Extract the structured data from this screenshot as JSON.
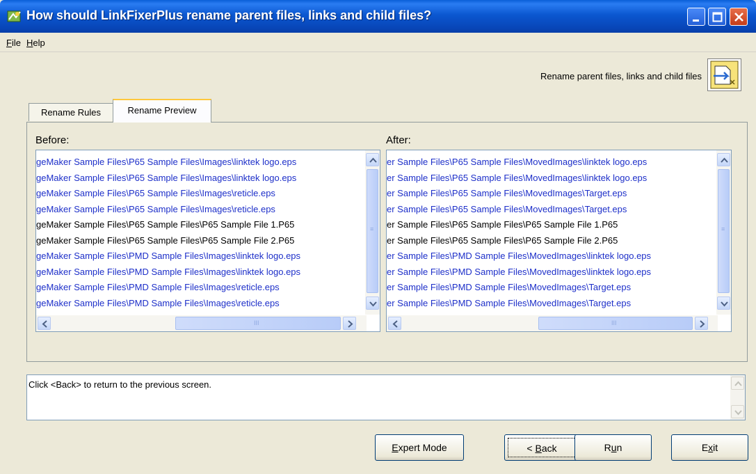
{
  "window": {
    "title": "How should LinkFixerPlus rename parent files, links and child files?"
  },
  "menu": {
    "file": {
      "label_rest": "ile",
      "accel": "F"
    },
    "help": {
      "label_rest": "elp",
      "accel": "H"
    }
  },
  "header": {
    "caption": "Rename parent files, links and child files",
    "icon": "rename-files-icon"
  },
  "tabs": [
    {
      "label": "Rename Rules",
      "selected": false
    },
    {
      "label": "Rename Preview",
      "selected": true
    }
  ],
  "before": {
    "label": "Before:",
    "rows": [
      {
        "text": "geMaker Sample Files\\P65 Sample Files\\Images\\linktek logo.eps",
        "color": "blue"
      },
      {
        "text": "geMaker Sample Files\\P65 Sample Files\\Images\\linktek logo.eps",
        "color": "blue"
      },
      {
        "text": "geMaker Sample Files\\P65 Sample Files\\Images\\reticle.eps",
        "color": "blue"
      },
      {
        "text": "geMaker Sample Files\\P65 Sample Files\\Images\\reticle.eps",
        "color": "blue"
      },
      {
        "text": "geMaker Sample Files\\P65 Sample Files\\P65 Sample File 1.P65",
        "color": "black"
      },
      {
        "text": "geMaker Sample Files\\P65 Sample Files\\P65 Sample File 2.P65",
        "color": "black"
      },
      {
        "text": "geMaker Sample Files\\PMD Sample Files\\Images\\linktek logo.eps",
        "color": "blue"
      },
      {
        "text": "geMaker Sample Files\\PMD Sample Files\\Images\\linktek logo.eps",
        "color": "blue"
      },
      {
        "text": "geMaker Sample Files\\PMD Sample Files\\Images\\reticle.eps",
        "color": "blue"
      },
      {
        "text": "geMaker Sample Files\\PMD Sample Files\\Images\\reticle.eps",
        "color": "blue"
      }
    ]
  },
  "after": {
    "label": "After:",
    "rows": [
      {
        "text": "er Sample Files\\P65 Sample Files\\MovedImages\\linktek logo.eps",
        "color": "blue"
      },
      {
        "text": "er Sample Files\\P65 Sample Files\\MovedImages\\linktek logo.eps",
        "color": "blue"
      },
      {
        "text": "er Sample Files\\P65 Sample Files\\MovedImages\\Target.eps",
        "color": "blue"
      },
      {
        "text": "er Sample Files\\P65 Sample Files\\MovedImages\\Target.eps",
        "color": "blue"
      },
      {
        "text": "er Sample Files\\P65 Sample Files\\P65 Sample File 1.P65",
        "color": "black"
      },
      {
        "text": "er Sample Files\\P65 Sample Files\\P65 Sample File 2.P65",
        "color": "black"
      },
      {
        "text": "er Sample Files\\PMD Sample Files\\MovedImages\\linktek logo.eps",
        "color": "blue"
      },
      {
        "text": "er Sample Files\\PMD Sample Files\\MovedImages\\linktek logo.eps",
        "color": "blue"
      },
      {
        "text": "er Sample Files\\PMD Sample Files\\MovedImages\\Target.eps",
        "color": "blue"
      },
      {
        "text": "er Sample Files\\PMD Sample Files\\MovedImages\\Target.eps",
        "color": "blue"
      }
    ]
  },
  "status": {
    "message": "Click <Back> to return to the previous screen."
  },
  "buttons": {
    "expert": {
      "accel": "E",
      "rest": "xpert Mode"
    },
    "back": {
      "pre": "< ",
      "accel": "B",
      "rest": "ack"
    },
    "run": {
      "pre": "R",
      "accel": "u",
      "rest": "n"
    },
    "exit": {
      "pre": "E",
      "accel": "x",
      "rest": "it"
    }
  },
  "colors": {
    "titlebar": "#0a5fd8",
    "link_blue": "#1d2fc9",
    "window_bg": "#ece9d8",
    "close_red": "#c43c1a"
  }
}
